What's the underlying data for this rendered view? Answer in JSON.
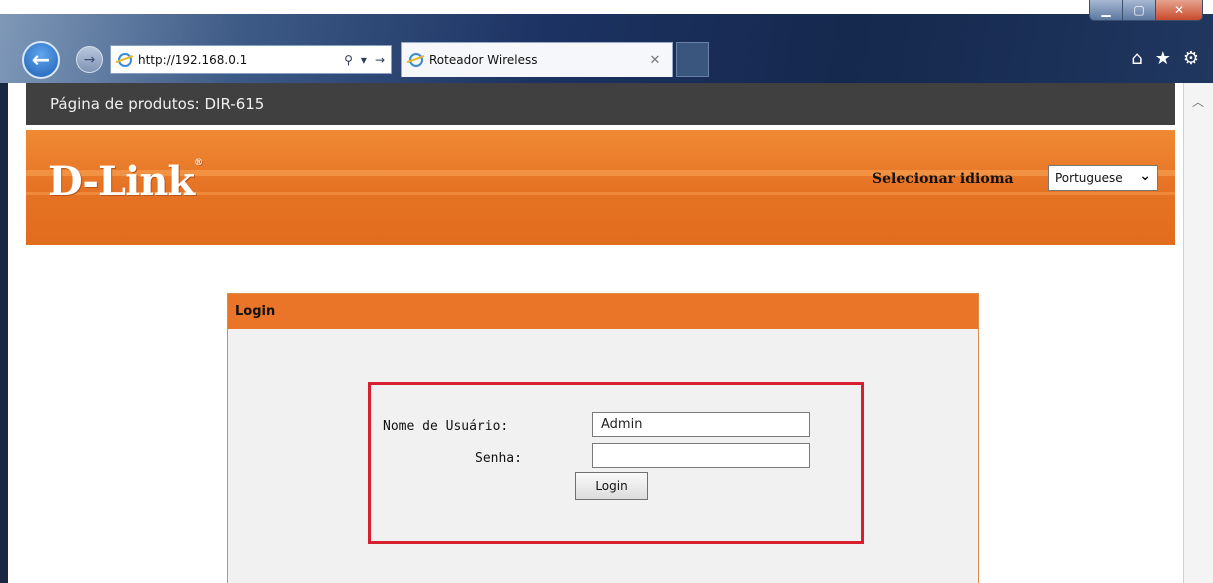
{
  "browser": {
    "url": "http://192.168.0.1",
    "tab_title": "Roteador Wireless",
    "window_controls": {
      "minimize_icon": "minimize-icon",
      "maximize_icon": "maximize-icon",
      "close_icon": "close-icon"
    },
    "toolbar_icons": [
      "home-icon",
      "star-icon",
      "gear-icon"
    ]
  },
  "page": {
    "product_bar": "Página de produtos: DIR-615",
    "logo": "D-Link",
    "language_label": "Selecionar idioma",
    "language_selected": "Portuguese",
    "accent_color": "#ea7529",
    "login": {
      "header": "Login",
      "username_label": "Nome de Usuário:",
      "username_value": "Admin",
      "password_label": "Senha:",
      "password_value": "",
      "submit_label": "Login",
      "highlight_color": "#d6202f"
    }
  }
}
